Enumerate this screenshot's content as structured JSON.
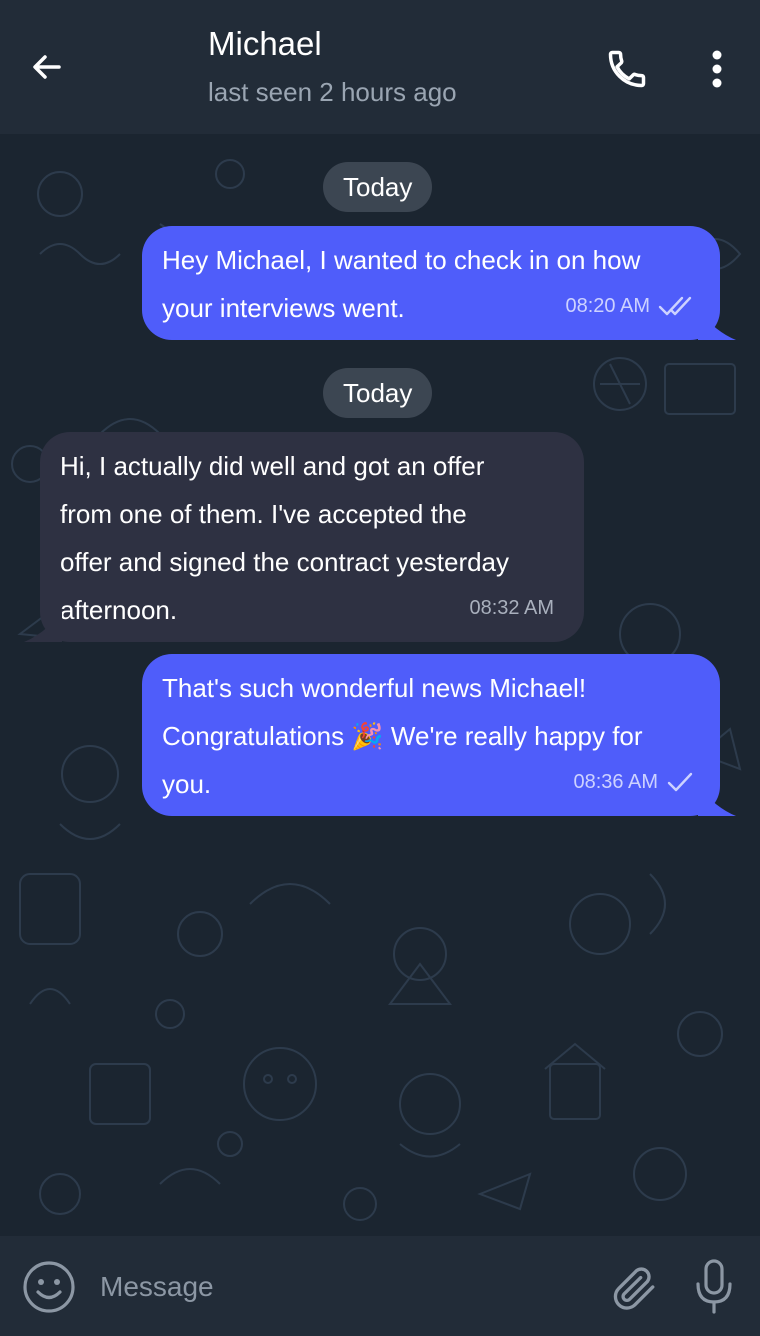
{
  "header": {
    "title": "Michael",
    "subtitle": "last seen 2 hours ago",
    "back_icon": "arrow-left-icon",
    "call_icon": "phone-icon",
    "menu_icon": "more-vertical-icon"
  },
  "messages": [
    {
      "date": "Today",
      "direction": "outgoing",
      "lines": [
        "Hey Michael, I wanted to check in on how",
        "your interviews went."
      ],
      "time": "08:20 AM",
      "status": "read"
    },
    {
      "date": "Today",
      "direction": "incoming",
      "lines": [
        "Hi, I actually did well and got an offer",
        "from one of them. I've accepted the",
        "offer and signed the contract yesterday",
        "afternoon."
      ],
      "time": "08:32 AM"
    },
    {
      "direction": "outgoing",
      "lines": [
        "That's such wonderful news Michael!",
        "Congratulations 🎉 We're really happy for",
        "you."
      ],
      "time": "08:36 AM",
      "status": "sent"
    }
  ],
  "composer": {
    "placeholder": "Message",
    "emoji_icon": "smiley-icon",
    "attach_icon": "paperclip-icon",
    "mic_icon": "microphone-icon"
  },
  "colors": {
    "outgoing_bubble": "#4f5dfa",
    "incoming_bubble": "#2e3142",
    "header_bg": "#222c38",
    "chat_bg": "#1b2530"
  }
}
